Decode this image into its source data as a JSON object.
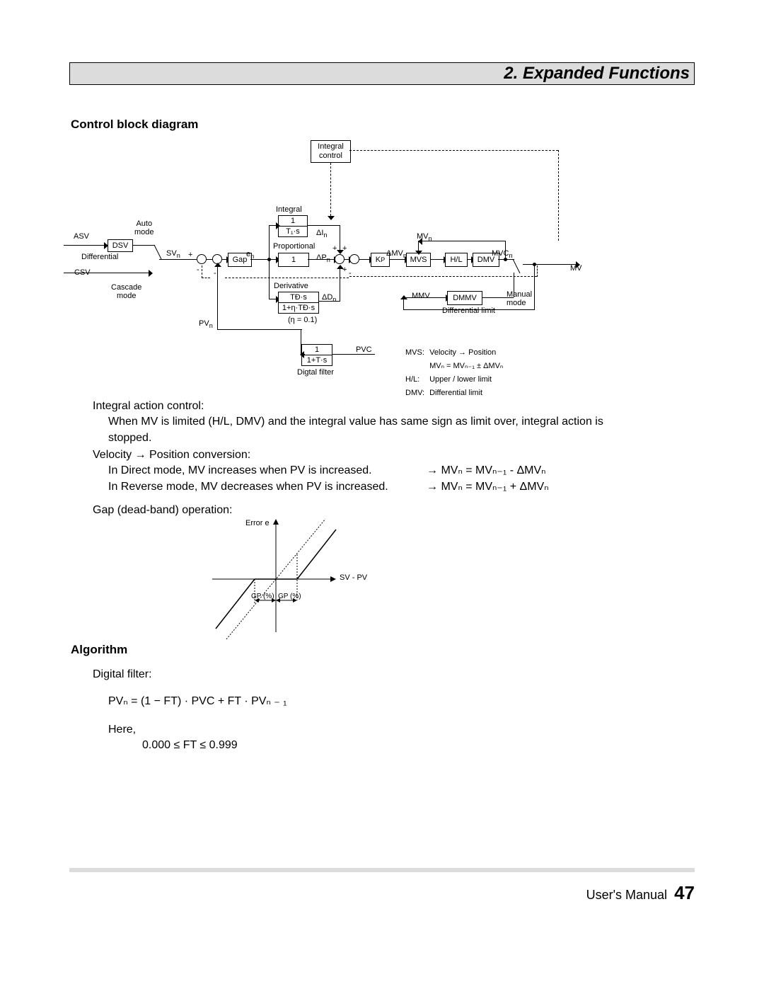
{
  "header": {
    "title": "2. Expanded Functions"
  },
  "sections": {
    "control_block": "Control block diagram",
    "algorithm": "Algorithm"
  },
  "diagram": {
    "integral_control": "Integral\ncontrol",
    "integral_label": "Integral",
    "integral_tf_num": "1",
    "integral_tf_den": "T₁·s",
    "delta_I": "ΔI",
    "auto_mode": "Auto\nmode",
    "asv": "ASV",
    "dsv": "DSV",
    "differential": "Differential",
    "svn": "SV",
    "csv": "CSV",
    "cascade_mode": "Cascade\nmode",
    "pvn": "PV",
    "gap": "Gap",
    "en": "e",
    "proportional": "Proportional",
    "prop_box": "1",
    "delta_P": "ΔP",
    "derivative": "Derivative",
    "deriv_num": "TƉ·s",
    "deriv_den": "1+η·TƉ·s",
    "delta_D": "ΔD",
    "eta_note": "(η = 0.1)",
    "kp": "K",
    "kp_sub": "P",
    "delta_MV": "ΔMV",
    "mvs": "MVS",
    "mvn": "MV",
    "hl": "H/L",
    "dmv": "DMV",
    "mvcn": "MVC",
    "mv_out": "MV",
    "mmv": "MMV",
    "dmmv": "DMMV",
    "diff_limit": "Differential limit",
    "manual_mode": "Manual\nmode",
    "digital_filter_label": "Digtal filter",
    "df_num": "1",
    "df_den": "1+T·s",
    "pvc": "PVC",
    "plus": "+",
    "minus": "-"
  },
  "legend": {
    "mvs_label": "MVS:",
    "mvs_text1": "Velocity → Position",
    "mvs_text2": "MVₙ = MVₙ₋₁ ± ΔMVₙ",
    "hl_label": "H/L:",
    "hl_text": "Upper / lower limit",
    "dmv_label": "DMV:",
    "dmv_text": "Differential limit"
  },
  "text": {
    "integral_action_title": "Integral action control:",
    "integral_action_body": "When MV is limited (H/L, DMV) and the integral value has same sign as limit over, integral action is stopped.",
    "velocity_title": "Velocity → Position conversion:",
    "velocity_line1": "In Direct mode, MV increases when PV is increased.",
    "velocity_eq1": "→  MVₙ = MVₙ₋₁ - ΔMVₙ",
    "velocity_line2": "In Reverse mode, MV decreases when PV is increased.",
    "velocity_eq2": "→  MVₙ = MVₙ₋₁ + ΔMVₙ",
    "gap_title": "Gap (dead-band) operation:",
    "digital_filter_title": "Digital filter:",
    "df_formula": "PVₙ = (1 − FT) · PVC + FT · PVₙ ₋ ₁",
    "here": "Here,",
    "ft_range": "0.000 ≤ FT ≤ 0.999"
  },
  "gap_chart": {
    "ylabel": "Error e",
    "xlabel": "SV - PV",
    "gp_left": "GP (%)",
    "gp_right": "GP (%)"
  },
  "footer": {
    "manual": "User's Manual",
    "page": "47"
  }
}
